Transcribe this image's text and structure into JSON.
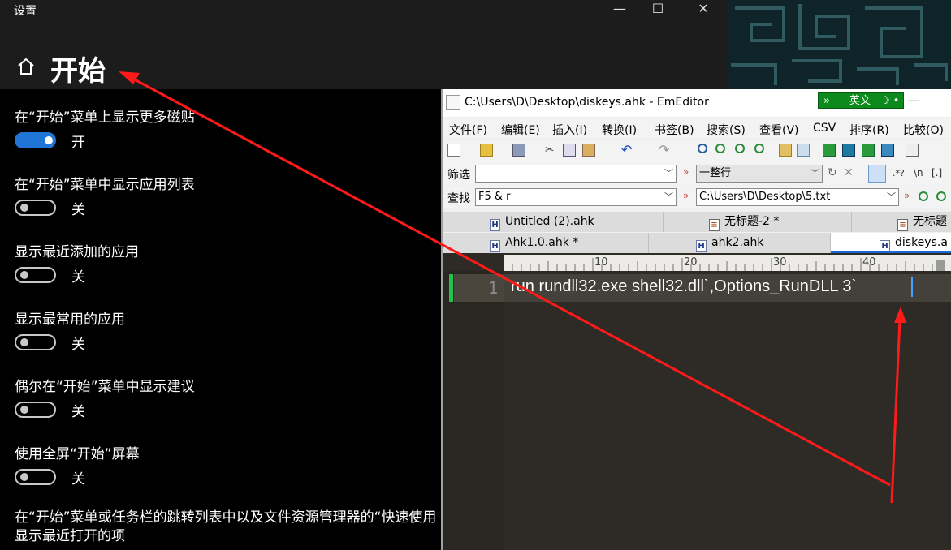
{
  "settings": {
    "app_title": "设置",
    "page_title": "开始",
    "window_controls": {
      "minimize": "—",
      "maximize": "☐",
      "close": "✕"
    },
    "items": [
      {
        "label": "在“开始”菜单上显示更多磁贴",
        "state": "开",
        "on": true
      },
      {
        "label": "在“开始”菜单中显示应用列表",
        "state": "关",
        "on": false
      },
      {
        "label": "显示最近添加的应用",
        "state": "关",
        "on": false
      },
      {
        "label": "显示最常用的应用",
        "state": "关",
        "on": false
      },
      {
        "label": "偶尔在“开始”菜单中显示建议",
        "state": "关",
        "on": false
      },
      {
        "label": "使用全屏“开始”屏幕",
        "state": "关",
        "on": false
      }
    ],
    "last_item_line1": "在“开始”菜单或任务栏的跳转列表中以及文件资源管理器的“快速使用",
    "last_item_line2": "显示最近打开的项"
  },
  "editor": {
    "title": "C:\\Users\\D\\Desktop\\diskeys.ahk - EmEditor",
    "ime": {
      "left": "»",
      "text": "英文",
      "right": "☽ •"
    },
    "minimize": "—",
    "menu": [
      "文件(F)",
      "编辑(E)",
      "插入(I)",
      "转换(I)",
      "书签(B)",
      "搜索(S)",
      "查看(V)",
      "CSV",
      "排序(R)",
      "比较(O)"
    ],
    "filter": {
      "label": "筛选",
      "value": "",
      "mode": "一整行",
      "regex": ".*?",
      "newline": "\\n",
      "brackets": "[.]"
    },
    "find": {
      "label": "查找",
      "value": "F5 & r",
      "path": "C:\\Users\\D\\Desktop\\5.txt"
    },
    "tabs_row1": [
      "Untitled (2).ahk",
      "无标题-2 *",
      "无标题"
    ],
    "tabs_row2": [
      "Ahk1.0.ahk *",
      "ahk2.ahk",
      "diskeys.a"
    ],
    "ruler": [
      "10",
      "20",
      "30",
      "40"
    ],
    "line_number": "1",
    "code": "run rundll32.exe shell32.dll`,Options_RunDLL 3`"
  },
  "colors": {
    "toggle_on": "#1f76d6",
    "arrow": "#ff1a1a",
    "editor_bg": "#2e2b26",
    "ime": "#0c8a1c"
  }
}
